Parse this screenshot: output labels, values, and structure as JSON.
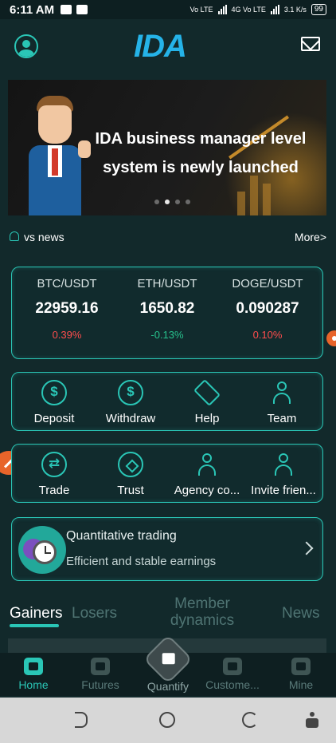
{
  "status_bar": {
    "time": "6:11 AM",
    "network1": "Vo LTE",
    "network2": "4G Vo LTE",
    "speed": "3.1 K/s",
    "battery": "99"
  },
  "header": {
    "logo": "IDA"
  },
  "banner": {
    "text": "IDA business manager level system is newly launched",
    "slide_count": 4,
    "active_slide": 1
  },
  "news": {
    "label": "vs news",
    "more": "More>"
  },
  "tickers": [
    {
      "pair": "BTC/USDT",
      "price": "22959.16",
      "change": "0.39%",
      "direction": "up"
    },
    {
      "pair": "ETH/USDT",
      "price": "1650.82",
      "change": "-0.13%",
      "direction": "down"
    },
    {
      "pair": "DOGE/USDT",
      "price": "0.090287",
      "change": "0.10%",
      "direction": "up"
    }
  ],
  "actions_row1": [
    {
      "label": "Deposit",
      "icon": "dollar-plus-icon"
    },
    {
      "label": "Withdraw",
      "icon": "dollar-minus-icon"
    },
    {
      "label": "Help",
      "icon": "handshake-icon"
    },
    {
      "label": "Team",
      "icon": "team-icon"
    }
  ],
  "actions_row2": [
    {
      "label": "Trade",
      "icon": "exchange-icon"
    },
    {
      "label": "Trust",
      "icon": "diamond-icon"
    },
    {
      "label": "Agency co...",
      "icon": "agency-icon"
    },
    {
      "label": "Invite frien...",
      "icon": "invite-user-icon"
    }
  ],
  "quant": {
    "title": "Quantitative trading",
    "subtitle": "Efficient and stable earnings"
  },
  "tabs": {
    "gainers": "Gainers",
    "losers": "Losers",
    "member_dynamics": "Member dynamics",
    "news": "News"
  },
  "bottom_nav": {
    "home": "Home",
    "futures": "Futures",
    "quantify": "Quantify",
    "customer": "Custome...",
    "mine": "Mine"
  },
  "colors": {
    "accent": "#2ac6b6",
    "background": "#12292b",
    "up": "#ff4d4d",
    "down": "#27c28d",
    "logo": "#25b3e8"
  }
}
